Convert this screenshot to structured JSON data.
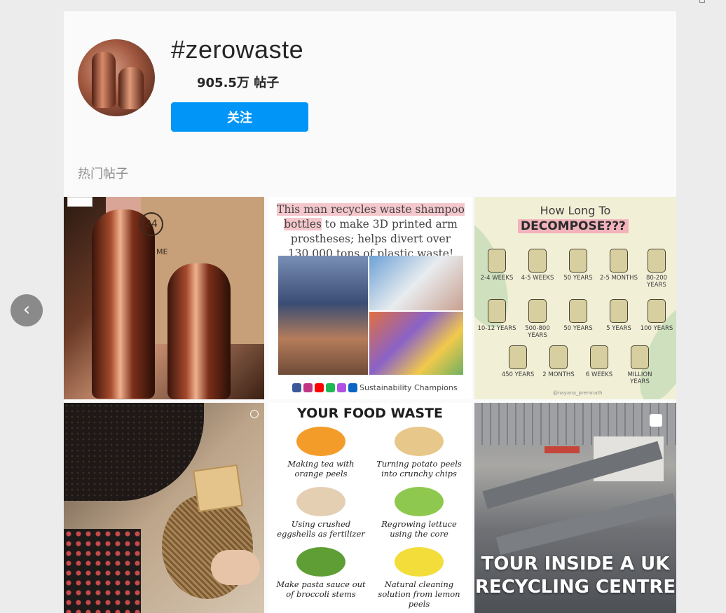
{
  "header": {
    "hashtag": "#zerowaste",
    "post_count": "905.5万 帖子",
    "follow_label": "关注"
  },
  "section": {
    "title": "热门帖子"
  },
  "posts": [
    {
      "id": "bottles",
      "logo_text": "24",
      "logo_sub": "ME"
    },
    {
      "id": "shampoo-bottles",
      "headline_highlight": "This man recycles waste shampoo bottles",
      "headline_rest": "to make 3D printed arm prostheses; helps divert over 130,000 tons of plastic waste!",
      "footer": "Sustainability Champions"
    },
    {
      "id": "decompose",
      "title": "How Long To",
      "subtitle": "DECOMPOSE???",
      "items": [
        "2-4 WEEKS",
        "4-5 WEEKS",
        "50 YEARS",
        "2-5 MONTHS",
        "80-200 YEARS",
        "10-12 YEARS",
        "500-800 YEARS",
        "50 YEARS",
        "5 YEARS",
        "100 YEARS",
        "450 YEARS",
        "2 MONTHS",
        "6 WEEKS",
        "MILLION YEARS"
      ],
      "credit": "@nayana_premnath"
    },
    {
      "id": "makeup"
    },
    {
      "id": "food-waste",
      "title": "YOUR FOOD WASTE",
      "items": [
        "Making tea with orange peels",
        "Turning potato peels into crunchy chips",
        "Using crushed eggshells as fertilizer",
        "Regrowing lettuce using the core",
        "Make pasta sauce out of broccoli stems",
        "Natural cleaning solution from lemon peels"
      ]
    },
    {
      "id": "recycling-centre",
      "caption": "TOUR INSIDE A UK RECYCLING CENTRE"
    }
  ],
  "colors": {
    "follow_button": "#0095f6",
    "highlight_pink": "#f4c7cc",
    "decompose_bg": "#f1efd6"
  },
  "icons": {
    "prev": "chevron-left-icon"
  }
}
